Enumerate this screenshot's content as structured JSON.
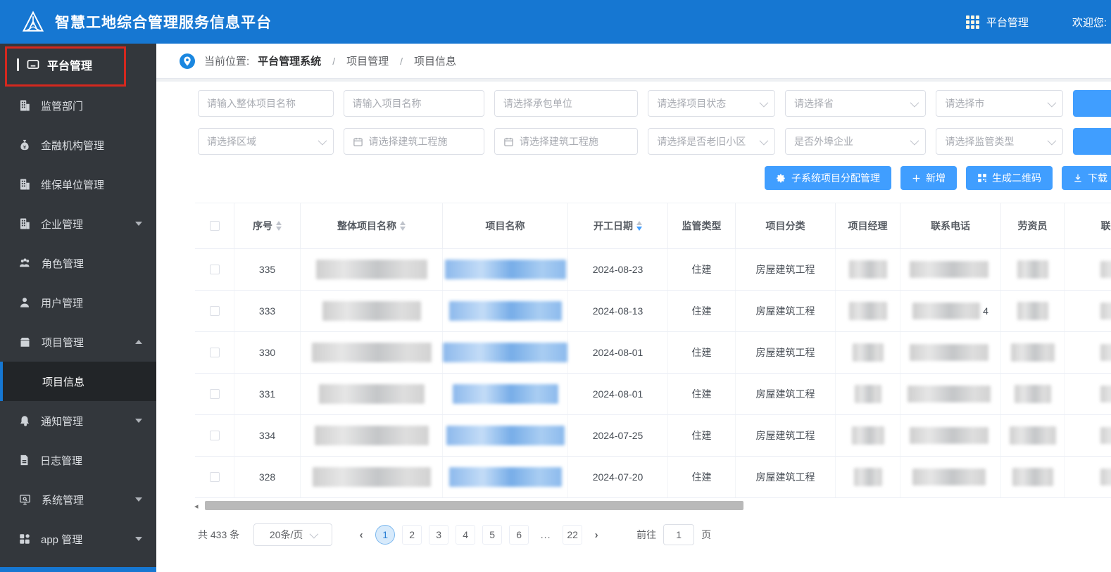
{
  "app": {
    "title": "智慧工地综合管理服务信息平台",
    "nav_label": "平台管理",
    "welcome": "欢迎您:"
  },
  "sidebar": {
    "header_label": "平台管理",
    "items": [
      {
        "label": "监管部门"
      },
      {
        "label": "金融机构管理"
      },
      {
        "label": "维保单位管理"
      },
      {
        "label": "企业管理"
      },
      {
        "label": "角色管理"
      },
      {
        "label": "用户管理"
      },
      {
        "label": "项目管理"
      },
      {
        "label": "通知管理"
      },
      {
        "label": "日志管理"
      },
      {
        "label": "系统管理"
      },
      {
        "label": "app 管理"
      }
    ],
    "submenu_active": "项目信息"
  },
  "breadcrumb": {
    "prefix": "当前位置:",
    "root": "平台管理系统",
    "sep": "/",
    "level1": "项目管理",
    "level2": "项目信息"
  },
  "filters": {
    "overall_name": "请输入整体项目名称",
    "project_name": "请输入项目名称",
    "contractor": "请选择承包单位",
    "status": "请选择项目状态",
    "province": "请选择省",
    "city": "请选择市",
    "region": "请选择区域",
    "build_date_start": "请选择建筑工程施",
    "build_date_end": "请选择建筑工程施",
    "old_district": "请选择是否老旧小区",
    "external_enterprise": "是否外埠企业",
    "supervision_type": "请选择监管类型"
  },
  "actions": {
    "assign": "子系统项目分配管理",
    "add": "新增",
    "qrcode": "生成二维码",
    "download": "下载"
  },
  "table": {
    "columns": {
      "seq": "序号",
      "overall": "整体项目名称",
      "project": "项目名称",
      "start": "开工日期",
      "supervision": "监管类型",
      "category": "项目分类",
      "manager": "项目经理",
      "phone": "联系电话",
      "labor": "劳资员",
      "phone2": "联系电话"
    },
    "rows": [
      {
        "seq": "335",
        "start": "2024-08-23",
        "supervision": "住建",
        "category": "房屋建筑工程",
        "phone_suffix": ""
      },
      {
        "seq": "333",
        "start": "2024-08-13",
        "supervision": "住建",
        "category": "房屋建筑工程",
        "phone_suffix": "4"
      },
      {
        "seq": "330",
        "start": "2024-08-01",
        "supervision": "住建",
        "category": "房屋建筑工程",
        "phone_suffix": ""
      },
      {
        "seq": "331",
        "start": "2024-08-01",
        "supervision": "住建",
        "category": "房屋建筑工程",
        "phone_suffix": ""
      },
      {
        "seq": "334",
        "start": "2024-07-25",
        "supervision": "住建",
        "category": "房屋建筑工程",
        "phone_suffix": ""
      },
      {
        "seq": "328",
        "start": "2024-07-20",
        "supervision": "住建",
        "category": "房屋建筑工程",
        "phone_suffix": ""
      }
    ]
  },
  "pagination": {
    "total": "共 433 条",
    "page_size": "20条/页",
    "pages": [
      "1",
      "2",
      "3",
      "4",
      "5",
      "6",
      "...",
      "22"
    ],
    "active_page": "1",
    "prev": "‹",
    "next": "›",
    "goto_label": "前往",
    "goto_value": "1",
    "goto_suffix": "页"
  },
  "colors": {
    "header_blue": "#1677d2",
    "accent_blue": "#409eff",
    "sidebar_dark": "#33373c",
    "annotation_red": "#d5281e",
    "active_sort": "#409eff"
  }
}
